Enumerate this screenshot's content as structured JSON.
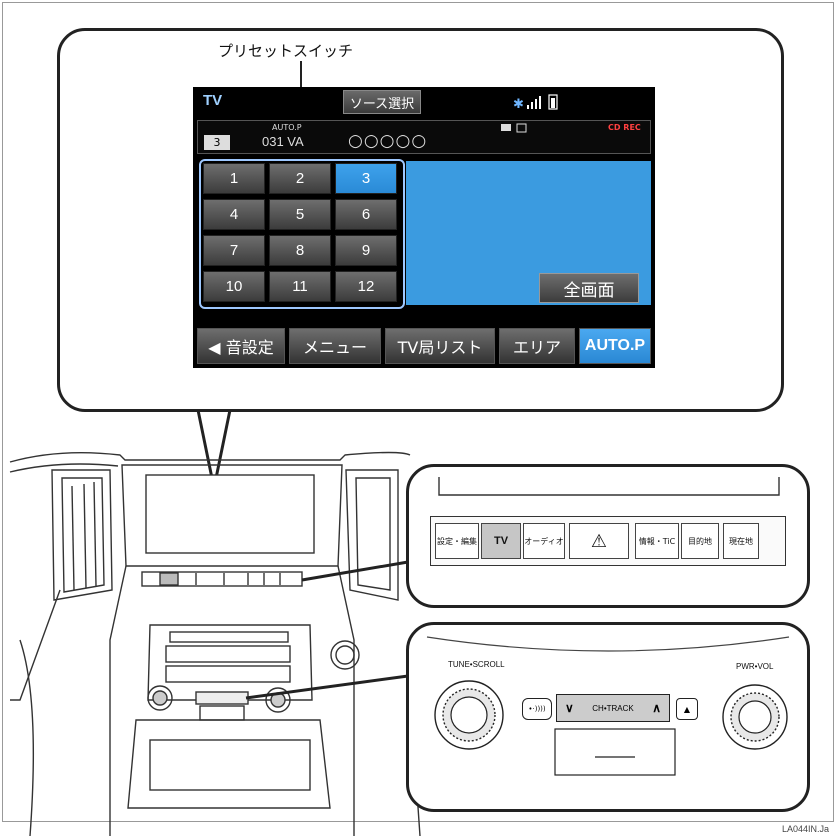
{
  "callout_caption": "プリセットスイッチ",
  "screen": {
    "source_label": "TV",
    "source_select_button": "ソース選択",
    "channel_number": "3",
    "autop_small": "AUTO.P",
    "channel_code": "031 VA",
    "station_name": "○○○○○",
    "cd_rec": "CD REC",
    "presets": [
      "1",
      "2",
      "3",
      "4",
      "5",
      "6",
      "7",
      "8",
      "9",
      "10",
      "11",
      "12"
    ],
    "selected_preset": "3",
    "fullscreen_button": "全画面",
    "bottom_buttons": [
      {
        "label": "◀ 音設定"
      },
      {
        "label": "メニュー"
      },
      {
        "label": "TV局リスト"
      },
      {
        "label": "エリア"
      },
      {
        "label": "AUTO.P",
        "active": true
      }
    ],
    "colors": {
      "accent_blue": "#3b9be0",
      "label_blue": "#9fd0ff",
      "rec_red": "#ff4040"
    }
  },
  "head_unit_buttons": [
    "設定・編集",
    "TV",
    "オーディオ",
    "⚠",
    "情報・TiC",
    "目的地",
    "現在地"
  ],
  "controls": {
    "left_knob_label": "TUNE•SCROLL",
    "right_knob_label": "PWR•VOL",
    "ch_track_label": "CH•TRACK",
    "ch_down": "∨",
    "ch_up": "∧",
    "radio_button": "•·))))",
    "eject_button": "▲"
  },
  "figure_code": "LA044IN.Ja"
}
